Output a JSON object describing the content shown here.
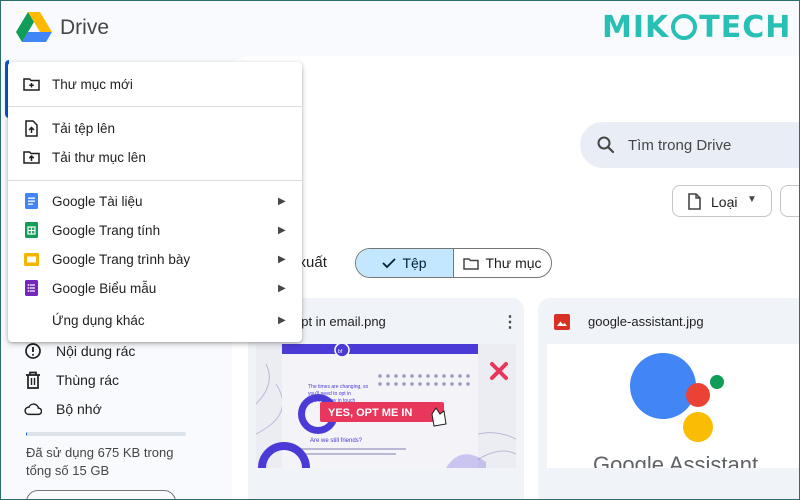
{
  "header": {
    "app_name": "Drive",
    "brand_left": "MIK",
    "brand_right": "TECH"
  },
  "search": {
    "placeholder": "Tìm trong Drive",
    "icon": "search-icon"
  },
  "filters": {
    "type_label": "Loại",
    "suggested_label": "ề xuất",
    "segment_files": "Tệp",
    "segment_folders": "Thư mục"
  },
  "new_menu": {
    "items": [
      {
        "label": "Thư mục mới",
        "icon": "folder-plus-icon"
      },
      {
        "label": "Tải tệp lên",
        "icon": "file-upload-icon"
      },
      {
        "label": "Tải thư mục lên",
        "icon": "folder-upload-icon"
      },
      {
        "label": "Google Tài liệu",
        "icon": "docs-icon",
        "color": "#4285f4",
        "submenu": true
      },
      {
        "label": "Google Trang tính",
        "icon": "sheets-icon",
        "color": "#0f9d58",
        "submenu": true
      },
      {
        "label": "Google Trang trình bày",
        "icon": "slides-icon",
        "color": "#f4b400",
        "submenu": true
      },
      {
        "label": "Google Biểu mẫu",
        "icon": "forms-icon",
        "color": "#7627bb",
        "submenu": true
      },
      {
        "label": "Ứng dụng khác",
        "icon": "",
        "submenu": true
      }
    ]
  },
  "sidebar": {
    "items": [
      {
        "label": "Nội dung rác",
        "icon": "spam-icon"
      },
      {
        "label": "Thùng rác",
        "icon": "trash-icon"
      },
      {
        "label": "Bộ nhớ",
        "icon": "cloud-icon"
      }
    ],
    "storage_used_fraction": 4.37e-05,
    "storage_text": "Đã sử dụng 675 KB trong tổng số 15 GB"
  },
  "files": [
    {
      "name": "opt in email.png",
      "thumb_button": "YES, OPT ME IN",
      "thumb_text_1": "The times are changing, so you'll need to opt in again to stay in touch",
      "thumb_text_2": "Are we still friends?"
    },
    {
      "name": "google-assistant.jpg",
      "thumb_caption": "Google Assistant"
    }
  ],
  "colors": {
    "accent": "#0b57d0",
    "selected_chip": "#c2e7ff",
    "brand": "#28c0b4"
  }
}
